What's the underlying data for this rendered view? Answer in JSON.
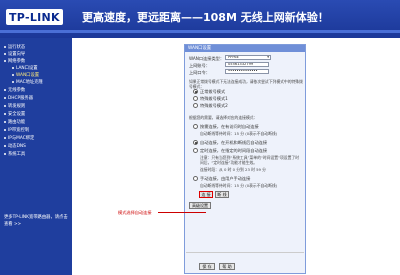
{
  "header": {
    "logo": "TP-LINK",
    "slogan": "更高速度，更远距离——108M 无线上网新体验！"
  },
  "sidebar": {
    "items": [
      {
        "label": "运行状态"
      },
      {
        "label": "设置向导"
      },
      {
        "label": "网络参数"
      },
      {
        "label": "LAN口设置"
      },
      {
        "label": "WAN口设置"
      },
      {
        "label": "MAC地址克隆"
      },
      {
        "label": "无线参数"
      },
      {
        "label": "DHCP服务器"
      },
      {
        "label": "转发规则"
      },
      {
        "label": "安全设置"
      },
      {
        "label": "路由功能"
      },
      {
        "label": "IP带宽控制"
      },
      {
        "label": "IP与MAC绑定"
      },
      {
        "label": "动态DNS"
      },
      {
        "label": "系统工具"
      }
    ],
    "help": "更多TP-LINK宽带路由器，请点击查看 >>"
  },
  "panel": {
    "title": "WAN口设置",
    "conn_type_label": "WAN口连接类型：",
    "conn_type_value": "PPPoE",
    "username_label": "上网账号：",
    "username_value": "05561332799",
    "password_label": "上网口令：",
    "password_value": "••••••••••••••",
    "special_dial_label": "如果正常拨号模式下无法连接成功，请依次尝试下列模式中的特殊拨号模式：",
    "dial_modes": [
      {
        "label": "正常拨号模式",
        "selected": true
      },
      {
        "label": "特殊拨号模式1",
        "selected": false
      },
      {
        "label": "特殊拨号模式2",
        "selected": false
      }
    ],
    "mode_section_label": "根据您的需要，请选择对应的连接模式：",
    "on_demand_label": "按需连接，在有访问时自动连接",
    "on_demand_idle": "自动断线等待时间：15 分 (0表示不自动断线)",
    "auto_label": "自动连接，在开机和断线后自动连接",
    "timed_label": "定时连接，在指定的时间段自动连接",
    "timed_note": "注意：只有当您到“系统工具”菜单的“时间设置”项设置了时间后，“定时连接”功能才能生效。",
    "timed_range": "连接时段：从 0 时 0 分到 23 时 59 分",
    "manual_label": "手动连接，由用户手动连接",
    "manual_idle": "自动断线等待时间：15 分 (0表示不自动断线)",
    "connect_button": "连 接",
    "disconnect_button": "断 线",
    "advanced_button": "高级设置",
    "save_button": "保 存",
    "help_button": "帮 助"
  },
  "callout": "模式选择自动连接"
}
